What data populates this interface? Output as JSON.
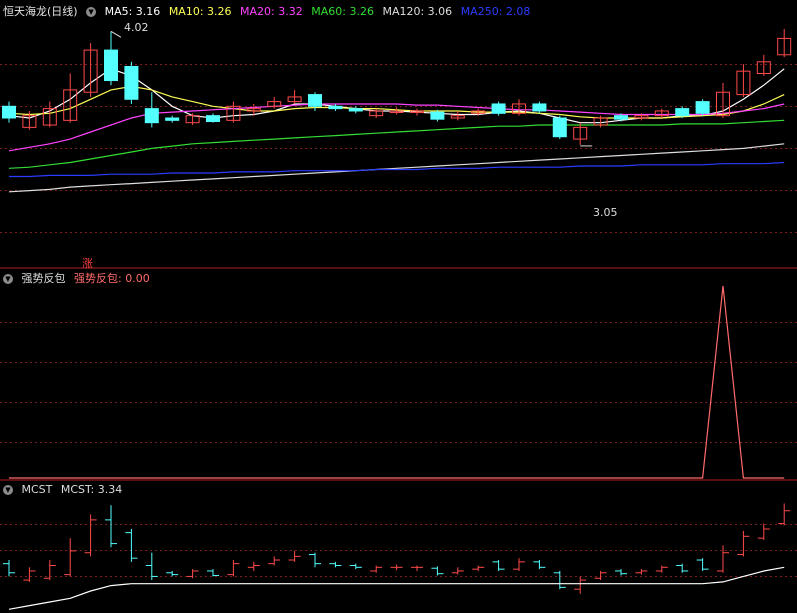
{
  "colors": {
    "up": "#ff4a4a",
    "down": "#54ffff",
    "ma5": "#ffffff",
    "ma10": "#ffff55",
    "ma20": "#ff44ff",
    "ma60": "#33dd33",
    "ma120": "#dddddd",
    "ma250": "#2a3cff",
    "grid": "#7a1e1e",
    "signal": "#ff6a6a"
  },
  "main_panel": {
    "title": "恒天海龙(日线)",
    "toggle_icon": "chevron-down-icon",
    "indicators": [
      {
        "label": "MA5: 3.16",
        "color": "#ffffff"
      },
      {
        "label": "MA10: 3.26",
        "color": "#ffff55"
      },
      {
        "label": "MA20: 3.32",
        "color": "#ff44ff"
      },
      {
        "label": "MA60: 3.26",
        "color": "#33dd33"
      },
      {
        "label": "MA120: 3.06",
        "color": "#dddddd"
      },
      {
        "label": "MA250: 2.08",
        "color": "#2a3cff"
      }
    ],
    "high_label": "4.02",
    "low_label": "3.05",
    "marker": "涨"
  },
  "signal_panel": {
    "name": "强势反包",
    "value_label": "强势反包: 0.00"
  },
  "mcst_panel": {
    "name": "MCST",
    "value_label": "MCST: 3.34"
  },
  "chart_data": {
    "type": "candlestick",
    "price_range": [
      2.05,
      4.1
    ],
    "candles": [
      {
        "o": 3.38,
        "c": 3.28,
        "h": 3.42,
        "l": 3.24
      },
      {
        "o": 3.2,
        "c": 3.3,
        "h": 3.34,
        "l": 3.18
      },
      {
        "o": 3.22,
        "c": 3.36,
        "h": 3.42,
        "l": 3.2
      },
      {
        "o": 3.26,
        "c": 3.52,
        "h": 3.66,
        "l": 3.24
      },
      {
        "o": 3.5,
        "c": 3.86,
        "h": 3.92,
        "l": 3.46
      },
      {
        "o": 3.86,
        "c": 3.6,
        "h": 4.02,
        "l": 3.56
      },
      {
        "o": 3.72,
        "c": 3.44,
        "h": 3.76,
        "l": 3.4
      },
      {
        "o": 3.36,
        "c": 3.24,
        "h": 3.5,
        "l": 3.2
      },
      {
        "o": 3.28,
        "c": 3.26,
        "h": 3.3,
        "l": 3.24
      },
      {
        "o": 3.24,
        "c": 3.3,
        "h": 3.32,
        "l": 3.22
      },
      {
        "o": 3.3,
        "c": 3.25,
        "h": 3.32,
        "l": 3.24
      },
      {
        "o": 3.26,
        "c": 3.38,
        "h": 3.42,
        "l": 3.24
      },
      {
        "o": 3.34,
        "c": 3.36,
        "h": 3.4,
        "l": 3.3
      },
      {
        "o": 3.38,
        "c": 3.42,
        "h": 3.46,
        "l": 3.36
      },
      {
        "o": 3.42,
        "c": 3.46,
        "h": 3.52,
        "l": 3.4
      },
      {
        "o": 3.48,
        "c": 3.38,
        "h": 3.5,
        "l": 3.34
      },
      {
        "o": 3.38,
        "c": 3.36,
        "h": 3.4,
        "l": 3.34
      },
      {
        "o": 3.36,
        "c": 3.34,
        "h": 3.38,
        "l": 3.32
      },
      {
        "o": 3.3,
        "c": 3.34,
        "h": 3.36,
        "l": 3.28
      },
      {
        "o": 3.34,
        "c": 3.34,
        "h": 3.37,
        "l": 3.31
      },
      {
        "o": 3.34,
        "c": 3.34,
        "h": 3.36,
        "l": 3.3
      },
      {
        "o": 3.33,
        "c": 3.27,
        "h": 3.35,
        "l": 3.25
      },
      {
        "o": 3.28,
        "c": 3.3,
        "h": 3.34,
        "l": 3.26
      },
      {
        "o": 3.32,
        "c": 3.34,
        "h": 3.36,
        "l": 3.3
      },
      {
        "o": 3.4,
        "c": 3.32,
        "h": 3.42,
        "l": 3.3
      },
      {
        "o": 3.32,
        "c": 3.4,
        "h": 3.44,
        "l": 3.3
      },
      {
        "o": 3.4,
        "c": 3.34,
        "h": 3.42,
        "l": 3.32
      },
      {
        "o": 3.28,
        "c": 3.12,
        "h": 3.3,
        "l": 3.1
      },
      {
        "o": 3.1,
        "c": 3.2,
        "h": 3.24,
        "l": 3.05
      },
      {
        "o": 3.22,
        "c": 3.28,
        "h": 3.3,
        "l": 3.2
      },
      {
        "o": 3.3,
        "c": 3.27,
        "h": 3.32,
        "l": 3.25
      },
      {
        "o": 3.28,
        "c": 3.3,
        "h": 3.32,
        "l": 3.26
      },
      {
        "o": 3.3,
        "c": 3.34,
        "h": 3.36,
        "l": 3.28
      },
      {
        "o": 3.36,
        "c": 3.3,
        "h": 3.38,
        "l": 3.28
      },
      {
        "o": 3.42,
        "c": 3.32,
        "h": 3.44,
        "l": 3.3
      },
      {
        "o": 3.3,
        "c": 3.5,
        "h": 3.58,
        "l": 3.28
      },
      {
        "o": 3.48,
        "c": 3.68,
        "h": 3.74,
        "l": 3.46
      },
      {
        "o": 3.66,
        "c": 3.76,
        "h": 3.82,
        "l": 3.64
      },
      {
        "o": 3.82,
        "c": 3.96,
        "h": 4.04,
        "l": 3.8
      }
    ],
    "ma": {
      "ma5": [
        3.3,
        3.28,
        3.34,
        3.44,
        3.58,
        3.7,
        3.64,
        3.52,
        3.38,
        3.3,
        3.28,
        3.3,
        3.31,
        3.34,
        3.4,
        3.4,
        3.38,
        3.36,
        3.34,
        3.34,
        3.33,
        3.32,
        3.31,
        3.31,
        3.33,
        3.34,
        3.32,
        3.28,
        3.24,
        3.24,
        3.26,
        3.28,
        3.28,
        3.3,
        3.3,
        3.34,
        3.44,
        3.56,
        3.7
      ],
      "ma10": [
        3.32,
        3.31,
        3.32,
        3.36,
        3.44,
        3.52,
        3.55,
        3.52,
        3.46,
        3.42,
        3.38,
        3.36,
        3.34,
        3.34,
        3.36,
        3.37,
        3.37,
        3.36,
        3.36,
        3.35,
        3.34,
        3.34,
        3.34,
        3.33,
        3.33,
        3.33,
        3.32,
        3.31,
        3.29,
        3.28,
        3.28,
        3.28,
        3.28,
        3.29,
        3.3,
        3.31,
        3.34,
        3.4,
        3.48
      ],
      "ma20": [
        3.0,
        3.03,
        3.06,
        3.1,
        3.16,
        3.22,
        3.28,
        3.32,
        3.33,
        3.34,
        3.35,
        3.36,
        3.37,
        3.38,
        3.39,
        3.4,
        3.4,
        3.4,
        3.4,
        3.4,
        3.39,
        3.39,
        3.38,
        3.37,
        3.36,
        3.35,
        3.35,
        3.34,
        3.33,
        3.32,
        3.31,
        3.31,
        3.31,
        3.31,
        3.31,
        3.32,
        3.34,
        3.36,
        3.4
      ],
      "ma60": [
        2.85,
        2.86,
        2.88,
        2.9,
        2.93,
        2.96,
        2.99,
        3.02,
        3.04,
        3.06,
        3.07,
        3.08,
        3.09,
        3.1,
        3.11,
        3.12,
        3.13,
        3.14,
        3.15,
        3.16,
        3.17,
        3.18,
        3.19,
        3.2,
        3.21,
        3.21,
        3.22,
        3.22,
        3.22,
        3.22,
        3.22,
        3.22,
        3.22,
        3.23,
        3.23,
        3.23,
        3.24,
        3.25,
        3.26
      ],
      "ma120": [
        2.65,
        2.66,
        2.67,
        2.69,
        2.7,
        2.71,
        2.72,
        2.73,
        2.74,
        2.75,
        2.76,
        2.77,
        2.78,
        2.79,
        2.8,
        2.81,
        2.82,
        2.83,
        2.84,
        2.85,
        2.86,
        2.87,
        2.88,
        2.89,
        2.9,
        2.91,
        2.92,
        2.93,
        2.94,
        2.95,
        2.96,
        2.97,
        2.98,
        2.99,
        3.0,
        3.01,
        3.02,
        3.04,
        3.06
      ],
      "ma250": [
        2.78,
        2.78,
        2.79,
        2.79,
        2.79,
        2.8,
        2.8,
        2.8,
        2.81,
        2.81,
        2.81,
        2.82,
        2.82,
        2.82,
        2.83,
        2.83,
        2.83,
        2.83,
        2.84,
        2.84,
        2.84,
        2.85,
        2.85,
        2.85,
        2.86,
        2.86,
        2.86,
        2.86,
        2.87,
        2.87,
        2.87,
        2.88,
        2.88,
        2.88,
        2.88,
        2.89,
        2.89,
        2.89,
        2.9
      ]
    },
    "signal": [
      0,
      0,
      0,
      0,
      0,
      0,
      0,
      0,
      0,
      0,
      0,
      0,
      0,
      0,
      0,
      0,
      0,
      0,
      0,
      0,
      0,
      0,
      0,
      0,
      0,
      0,
      0,
      0,
      0,
      0,
      0,
      0,
      0,
      0,
      0,
      1,
      0,
      0,
      0
    ],
    "signal_range": [
      0,
      1
    ],
    "mcst": [
      2.88,
      2.92,
      2.96,
      3.0,
      3.08,
      3.14,
      3.16,
      3.16,
      3.16,
      3.16,
      3.16,
      3.16,
      3.16,
      3.16,
      3.16,
      3.16,
      3.16,
      3.16,
      3.16,
      3.16,
      3.16,
      3.16,
      3.16,
      3.16,
      3.16,
      3.16,
      3.16,
      3.16,
      3.16,
      3.16,
      3.16,
      3.16,
      3.16,
      3.16,
      3.16,
      3.18,
      3.24,
      3.3,
      3.34
    ],
    "mcst_range": [
      2.85,
      4.1
    ]
  }
}
